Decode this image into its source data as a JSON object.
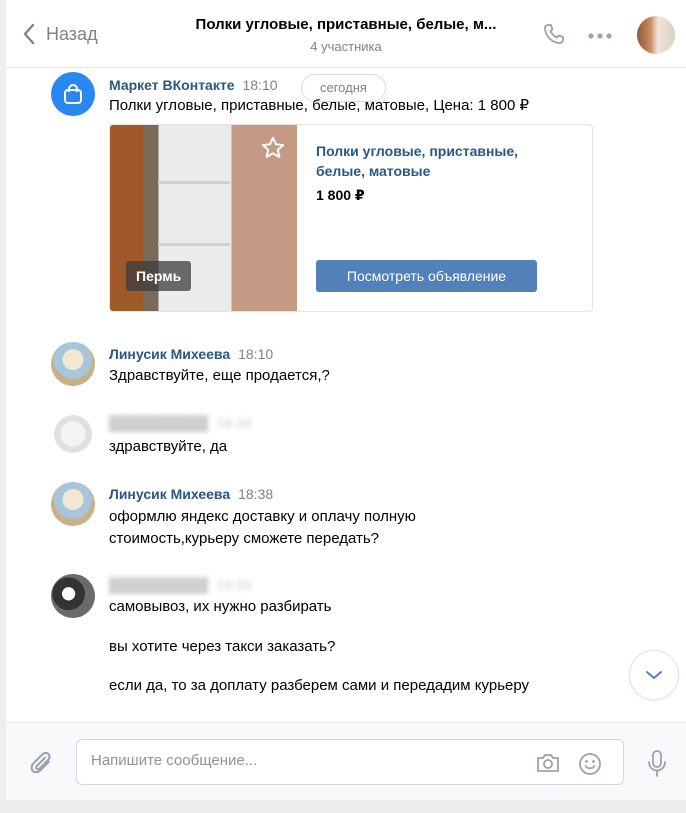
{
  "header": {
    "back_label": "Назад",
    "title": "Полки угловые, приставные, белые, м...",
    "subtitle": "4 участника"
  },
  "date_divider": "сегодня",
  "messages": [
    {
      "author": "Маркет ВКонтакте",
      "time": "18:10",
      "lines": [
        "Полки угловые, приставные, белые, матовые, Цена: 1 800 ₽"
      ],
      "card": {
        "title": "Полки угловые, приставные, белые, матовые",
        "price": "1 800 ₽",
        "city": "Пермь",
        "button": "Посмотреть объявление"
      }
    },
    {
      "author": "Линусик Михеева",
      "time": "18:10",
      "lines": [
        "Здравствуйте, еще продается,?"
      ]
    },
    {
      "author": "",
      "time": "18:38",
      "lines": [
        "здравствуйте, да"
      ]
    },
    {
      "author": "Линусик Михеева",
      "time": "18:38",
      "lines": [
        "оформлю яндекс доставку и оплачу полную",
        "стоимость,курьеру сможете передать?"
      ]
    },
    {
      "author": "",
      "time": "18:39",
      "lines": [
        "самовывоз, их нужно разбирать",
        "вы хотите через такси заказать?",
        "если да, то за доплату разберем сами и передадим курьеру"
      ]
    }
  ],
  "composer": {
    "placeholder": "Напишите сообщение..."
  },
  "icons": {
    "back": "chevron-left-icon",
    "call": "phone-icon",
    "more": "more-dots-icon",
    "attach": "paperclip-icon",
    "camera": "camera-icon",
    "emoji": "smile-icon",
    "mic": "microphone-icon",
    "scroll": "chevron-down-icon",
    "favorite": "star-icon",
    "market": "shopping-bag-icon"
  },
  "colors": {
    "accent": "#5181b8",
    "author": "#2a5885",
    "market": "#2b87f0"
  }
}
